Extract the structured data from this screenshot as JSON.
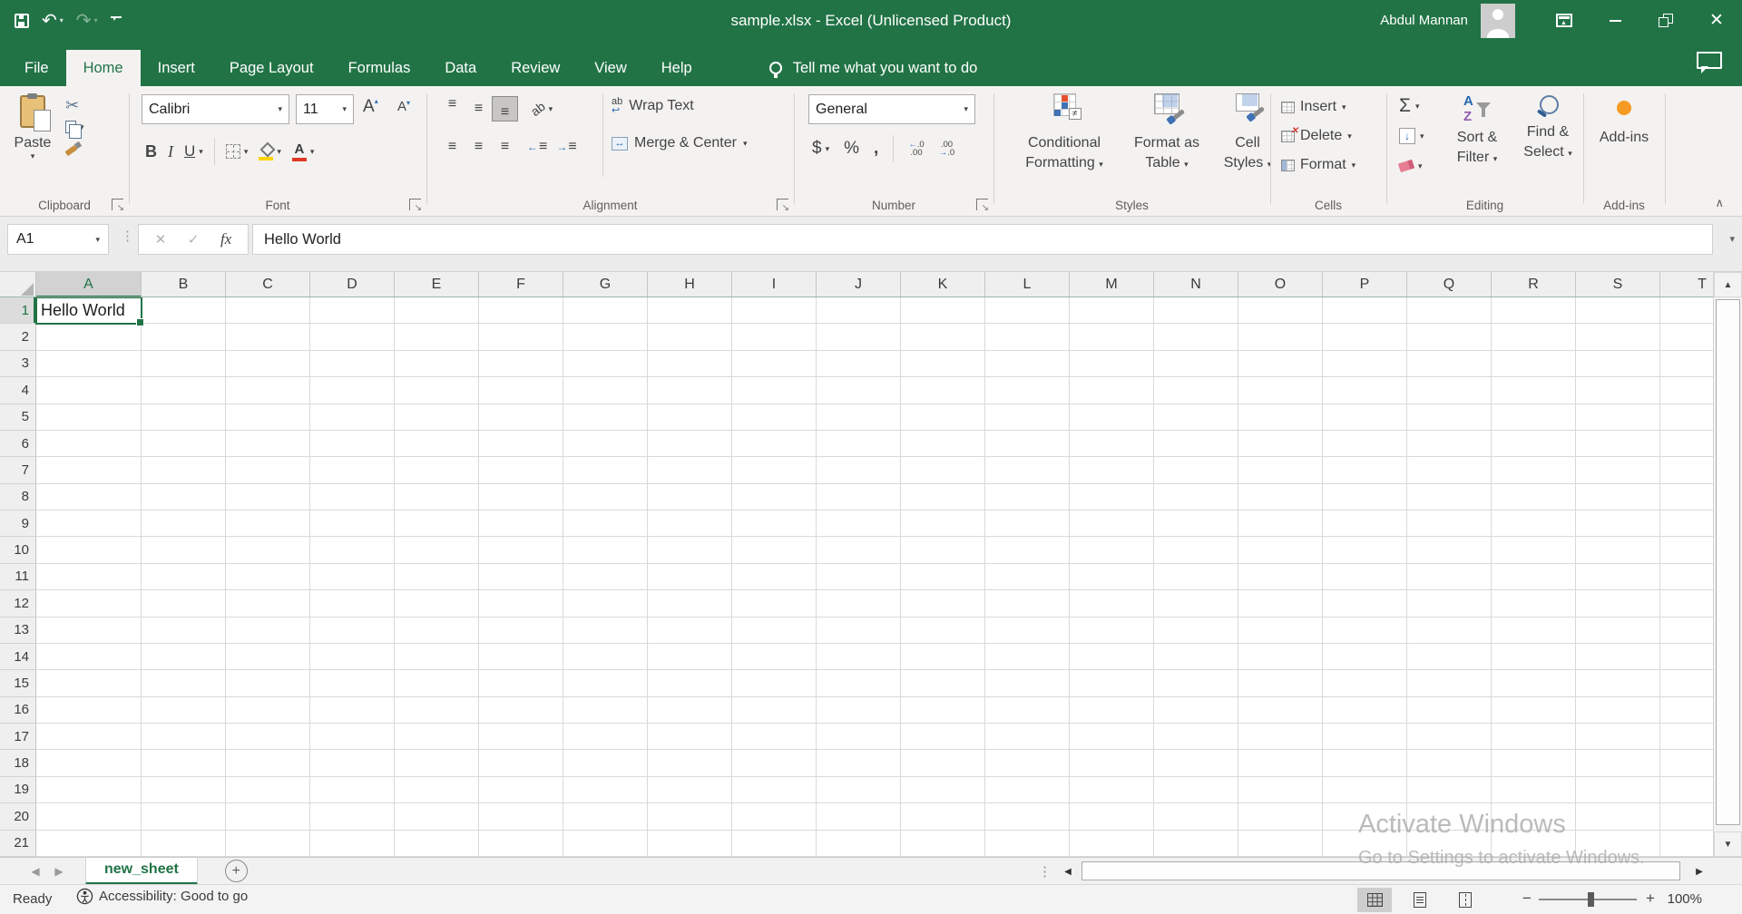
{
  "colors": {
    "excel_green": "#217346",
    "ribbon_bg": "#f3f2f1",
    "fill_yellow": "#ffd400",
    "font_red": "#e03826",
    "addin_orange": "#f59a23"
  },
  "title_bar": {
    "title": "sample.xlsx  -  Excel (Unlicensed Product)",
    "user_name": "Abdul Mannan"
  },
  "tabs": {
    "items": [
      {
        "label": "File"
      },
      {
        "label": "Home",
        "active": true
      },
      {
        "label": "Insert"
      },
      {
        "label": "Page Layout"
      },
      {
        "label": "Formulas"
      },
      {
        "label": "Data"
      },
      {
        "label": "Review"
      },
      {
        "label": "View"
      },
      {
        "label": "Help"
      }
    ],
    "tell_me": "Tell me what you want to do"
  },
  "ribbon": {
    "clipboard": {
      "paste_label": "Paste",
      "label": "Clipboard"
    },
    "font": {
      "font_name": "Calibri",
      "font_size": "11",
      "bold": "B",
      "italic": "I",
      "underline": "U",
      "label": "Font"
    },
    "alignment": {
      "wrap_text": "Wrap Text",
      "merge_center": "Merge & Center",
      "label": "Alignment"
    },
    "number": {
      "format": "General",
      "label": "Number"
    },
    "styles": {
      "conditional": "Conditional Formatting",
      "format_table": "Format as Table",
      "cell_styles": "Cell Styles",
      "label": "Styles"
    },
    "cells": {
      "insert": "Insert",
      "delete": "Delete",
      "format": "Format",
      "label": "Cells"
    },
    "editing": {
      "sort_filter": "Sort & Filter",
      "find_select": "Find & Select",
      "label": "Editing"
    },
    "addins": {
      "button": "Add-ins",
      "label": "Add-ins"
    }
  },
  "formula_bar": {
    "name_box": "A1",
    "fx_label": "fx",
    "content": "Hello World"
  },
  "grid": {
    "columns": [
      "A",
      "B",
      "C",
      "D",
      "E",
      "F",
      "G",
      "H",
      "I",
      "J",
      "K",
      "L",
      "M",
      "N",
      "O",
      "P",
      "Q",
      "R",
      "S",
      "T"
    ],
    "row_count": 21,
    "active_col": "A",
    "active_row": 1,
    "active_value": "Hello World"
  },
  "sheet_tabs": {
    "active_tab": "new_sheet"
  },
  "status_bar": {
    "mode": "Ready",
    "accessibility": "Accessibility: Good to go",
    "zoom_level": "100%"
  },
  "watermark": {
    "line1": "Activate Windows",
    "line2": "Go to Settings to activate Windows."
  },
  "icons": {
    "chevron_down": "▾",
    "chevron_up": "∧",
    "undo": "↶",
    "redo": "↷",
    "close": "✕",
    "arrow_left": "◀",
    "arrow_right": "▶",
    "arrow_up": "▲",
    "arrow_down": "▼",
    "dots_vertical": "⋮",
    "scissors": "✂",
    "cancel": "✕",
    "enter": "✓",
    "sigma": "Σ",
    "dollar": "$",
    "percent": "%",
    "comma": ",",
    "not_equal": "≠",
    "merge_arrows": "↔",
    "wrap_ab": "ab",
    "wrap_return": "↩",
    "lines": "≡",
    "grow_font": "A",
    "shrink_font": "A",
    "sort_a": "A",
    "sort_z": "Z",
    "orientation_ab": "ab",
    "fill_down": "↓",
    "plus": "+",
    "minus": "−",
    "arrow_sm_left": "←",
    "arrow_sm_right": "→",
    "dec0": ".0",
    "dec00": ".00",
    "launcher_arrow": "↘"
  }
}
